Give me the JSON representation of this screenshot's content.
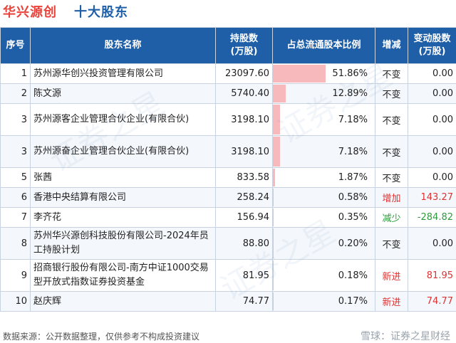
{
  "header": {
    "company": "华兴源创",
    "title": "十大股东"
  },
  "table": {
    "columns": [
      "序号",
      "股东名称",
      "持股数\n(万股)",
      "占总流通股本比例",
      "增减",
      "变动股数\n(万股)"
    ],
    "rows": [
      {
        "idx": "1",
        "name": "苏州源华创兴投资管理有限公司",
        "shares": "23097.60",
        "pct": "51.86%",
        "pct_value": 51.86,
        "change": "不变",
        "change_type": "flat",
        "delta": "0.00",
        "delta_type": "flat"
      },
      {
        "idx": "2",
        "name": "陈文源",
        "shares": "5740.40",
        "pct": "12.89%",
        "pct_value": 12.89,
        "change": "不变",
        "change_type": "flat",
        "delta": "0.00",
        "delta_type": "flat"
      },
      {
        "idx": "3",
        "name": "苏州源客企业管理合伙企业(有限合伙)",
        "shares": "3198.10",
        "pct": "7.18%",
        "pct_value": 7.18,
        "change": "不变",
        "change_type": "flat",
        "delta": "0.00",
        "delta_type": "flat"
      },
      {
        "idx": "3",
        "name": "苏州源奋企业管理合伙企业(有限合伙)",
        "shares": "3198.10",
        "pct": "7.18%",
        "pct_value": 7.18,
        "change": "不变",
        "change_type": "flat",
        "delta": "0.00",
        "delta_type": "flat"
      },
      {
        "idx": "5",
        "name": "张茜",
        "shares": "833.58",
        "pct": "1.87%",
        "pct_value": 1.87,
        "change": "不变",
        "change_type": "flat",
        "delta": "0.00",
        "delta_type": "flat"
      },
      {
        "idx": "6",
        "name": "香港中央结算有限公司",
        "shares": "258.24",
        "pct": "0.58%",
        "pct_value": 0.58,
        "change": "增加",
        "change_type": "up",
        "delta": "143.27",
        "delta_type": "up"
      },
      {
        "idx": "7",
        "name": "李齐花",
        "shares": "156.94",
        "pct": "0.35%",
        "pct_value": 0.35,
        "change": "减少",
        "change_type": "down",
        "delta": "-284.82",
        "delta_type": "down"
      },
      {
        "idx": "8",
        "name": "苏州华兴源创科技股份有限公司-2024年员工持股计划",
        "shares": "88.80",
        "pct": "0.20%",
        "pct_value": 0.2,
        "change": "不变",
        "change_type": "flat",
        "delta": "0.00",
        "delta_type": "flat"
      },
      {
        "idx": "9",
        "name": "招商银行股份有限公司-南方中证1000交易型开放式指数证券投资基金",
        "shares": "81.95",
        "pct": "0.18%",
        "pct_value": 0.18,
        "change": "新进",
        "change_type": "new",
        "delta": "81.95",
        "delta_type": "up"
      },
      {
        "idx": "10",
        "name": "赵庆辉",
        "shares": "74.77",
        "pct": "0.17%",
        "pct_value": 0.17,
        "change": "新进",
        "change_type": "new",
        "delta": "74.77",
        "delta_type": "up"
      }
    ]
  },
  "footer": {
    "note": "数据来源：公开数据整理，仅供参考不构成投资建议",
    "brand": "雪球：证券之星财经"
  },
  "watermark": "证券之星"
}
